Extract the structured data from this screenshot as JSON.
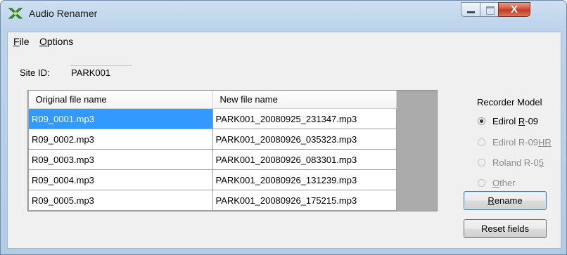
{
  "window": {
    "title": "Audio Renamer",
    "close_glyph": "X"
  },
  "menu": {
    "file": {
      "accel": "F",
      "rest": "ile"
    },
    "options": {
      "accel": "O",
      "rest": "ptions"
    }
  },
  "site": {
    "label": "Site ID:",
    "value": "PARK001"
  },
  "grid": {
    "columns": [
      "Original file name",
      "New file name"
    ],
    "rows": [
      {
        "original": "R09_0001.mp3",
        "new": "PARK001_20080925_231347.mp3"
      },
      {
        "original": "R09_0002.mp3",
        "new": "PARK001_20080926_035323.mp3"
      },
      {
        "original": "R09_0003.mp3",
        "new": "PARK001_20080926_083301.mp3"
      },
      {
        "original": "R09_0004.mp3",
        "new": "PARK001_20080926_131239.mp3"
      },
      {
        "original": "R09_0005.mp3",
        "new": "PARK001_20080926_175215.mp3"
      }
    ]
  },
  "recorder": {
    "title": "Recorder Model",
    "options": [
      {
        "pre": "Edirol ",
        "accel": "R",
        "post": "-09",
        "selected": true,
        "enabled": true
      },
      {
        "pre": "Edirol R-09",
        "accel": "HR",
        "post": "",
        "selected": false,
        "enabled": false
      },
      {
        "pre": "Roland R-0",
        "accel": "5",
        "post": "",
        "selected": false,
        "enabled": false
      },
      {
        "pre": "",
        "accel": "O",
        "post": "ther",
        "selected": false,
        "enabled": false
      }
    ]
  },
  "buttons": {
    "rename": {
      "accel": "R",
      "rest": "ename"
    },
    "reset": "Reset fields"
  },
  "icons": {
    "app": "audio-renamer-app-icon",
    "minimize": "minimize-icon",
    "maximize": "maximize-icon",
    "close": "close-icon"
  }
}
